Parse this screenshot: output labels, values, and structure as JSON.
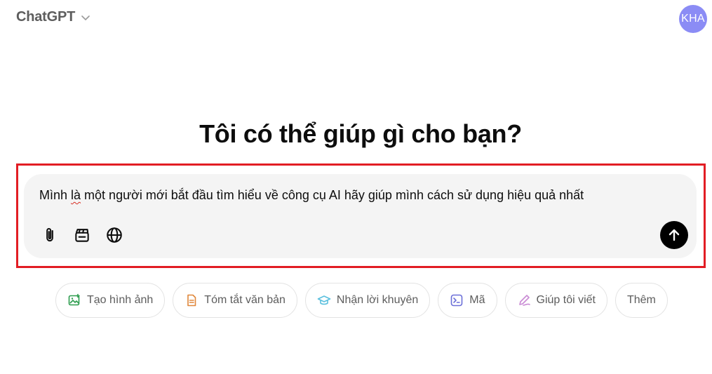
{
  "header": {
    "model_name": "ChatGPT",
    "avatar_initials": "KHA"
  },
  "main": {
    "title": "Tôi có thể giúp gì cho bạn?"
  },
  "composer": {
    "text_part1": "Mình ",
    "text_misspelled": "là",
    "text_part2": " một người mới bắt đầu tìm hiểu về công cụ AI hãy giúp mình cách sử dụng hiệu quả nhất",
    "tools": [
      "paperclip-icon",
      "clapperboard-icon",
      "globe-icon"
    ],
    "send_icon": "arrow-up-icon"
  },
  "chips": [
    {
      "label": "Tạo hình ảnh",
      "icon": "image-icon",
      "color": "#2e9d4f"
    },
    {
      "label": "Tóm tắt văn bản",
      "icon": "document-icon",
      "color": "#e0873a"
    },
    {
      "label": "Nhận lời khuyên",
      "icon": "graduation-cap-icon",
      "color": "#5bc0de"
    },
    {
      "label": "Mã",
      "icon": "terminal-icon",
      "color": "#6b6fd8"
    },
    {
      "label": "Giúp tôi viết",
      "icon": "pen-icon",
      "color": "#c98ad4"
    },
    {
      "label": "Thêm",
      "icon": "",
      "color": ""
    }
  ],
  "colors": {
    "avatar_bg": "#8b8cf5",
    "highlight_frame": "#e21d24",
    "composer_bg": "#f4f4f4",
    "send_bg": "#000000"
  }
}
